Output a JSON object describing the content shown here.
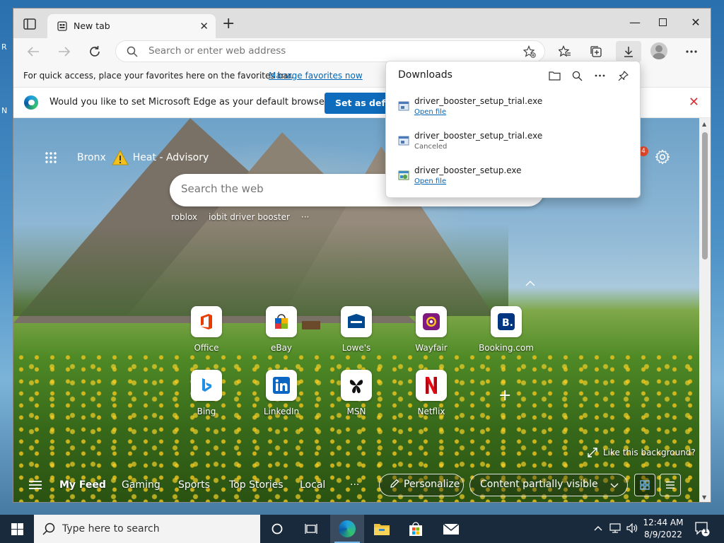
{
  "desktop": {
    "frag1": "R",
    "frag2": "N"
  },
  "browser": {
    "tab_title": "New tab",
    "address_placeholder": "Search or enter web address",
    "favbar_text": "For quick access, place your favorites here on the favorites bar.",
    "favbar_link": "Manage favorites now",
    "infobar_text": "Would you like to set Microsoft Edge as your default browser?",
    "infobar_button": "Set as default"
  },
  "downloads": {
    "title": "Downloads",
    "items": [
      {
        "name": "driver_booster_setup_trial.exe",
        "status": "Open file"
      },
      {
        "name": "driver_booster_setup_trial.exe",
        "status": "Canceled"
      },
      {
        "name": "driver_booster_setup.exe",
        "status": "Open file"
      }
    ]
  },
  "ntp": {
    "weather_city": "Bronx",
    "weather_alert": "Heat - Advisory",
    "notification_count": "4",
    "search_placeholder": "Search the web",
    "trending": [
      "roblox",
      "iobit driver booster"
    ],
    "trending_more": "···",
    "tiles": [
      {
        "label": "Office"
      },
      {
        "label": "eBay"
      },
      {
        "label": "Lowe's"
      },
      {
        "label": "Wayfair"
      },
      {
        "label": "Booking.com"
      },
      {
        "label": "Bing"
      },
      {
        "label": "LinkedIn"
      },
      {
        "label": "MSN"
      },
      {
        "label": "Netflix"
      }
    ],
    "add_tile": "+",
    "like_background": "Like this background?",
    "feed": {
      "items": [
        "My Feed",
        "Gaming",
        "Sports",
        "Top Stories",
        "Local"
      ],
      "more": "···",
      "personalize": "Personalize",
      "content_visibility": "Content partially visible"
    }
  },
  "taskbar": {
    "search_placeholder": "Type here to search",
    "time": "12:44 AM",
    "date": "8/9/2022",
    "notification_count": "1"
  },
  "colors": {
    "accent": "#0f6cbd",
    "link": "#0067b8",
    "close_red": "#d13438",
    "netflix_red": "#e50914",
    "booking_blue": "#003580",
    "linkedin_blue": "#0a66c2"
  }
}
